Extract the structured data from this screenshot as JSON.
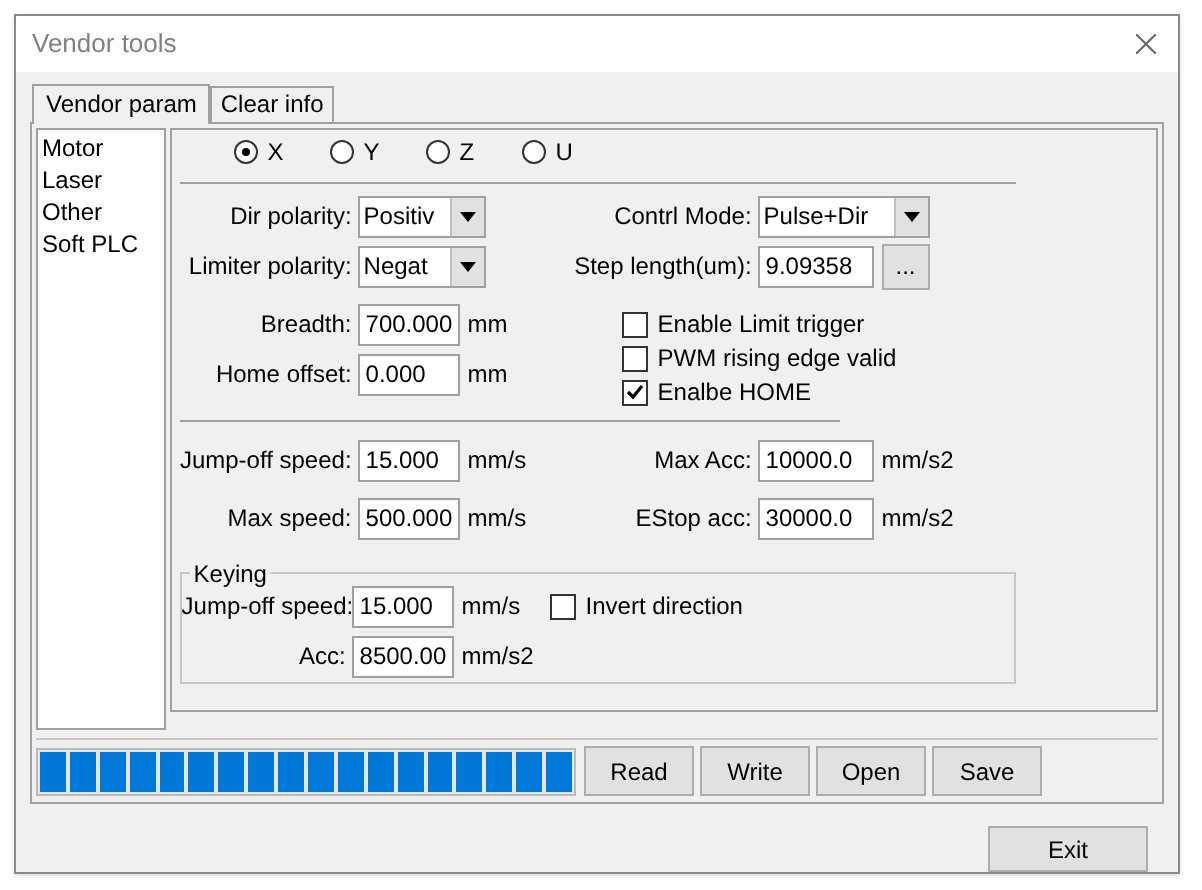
{
  "window": {
    "title": "Vendor tools"
  },
  "tabs": [
    {
      "label": "Vendor param",
      "selected": true
    },
    {
      "label": "Clear info",
      "selected": false
    }
  ],
  "sidebar": {
    "items": [
      "Motor",
      "Laser",
      "Other",
      "Soft PLC"
    ]
  },
  "axes": [
    {
      "label": "X",
      "selected": true
    },
    {
      "label": "Y",
      "selected": false
    },
    {
      "label": "Z",
      "selected": false
    },
    {
      "label": "U",
      "selected": false
    }
  ],
  "motor": {
    "dir_polarity": {
      "label": "Dir polarity:",
      "value": "Positiv"
    },
    "limiter_polarity": {
      "label": "Limiter polarity:",
      "value": "Negat"
    },
    "breadth": {
      "label": "Breadth:",
      "value": "700.000",
      "unit": "mm"
    },
    "home_offset": {
      "label": "Home offset:",
      "value": "0.000",
      "unit": "mm"
    },
    "control_mode": {
      "label": "Contrl Mode:",
      "value": "Pulse+Dir"
    },
    "step_length": {
      "label": "Step length(um):",
      "value": "9.09358",
      "button": "..."
    },
    "options": [
      {
        "label": "Enable Limit trigger",
        "checked": false
      },
      {
        "label": "PWM rising edge valid",
        "checked": false
      },
      {
        "label": "Enalbe HOME",
        "checked": true
      }
    ],
    "jump_off_speed": {
      "label": "Jump-off speed:",
      "value": "15.000",
      "unit": "mm/s"
    },
    "max_speed": {
      "label": "Max speed:",
      "value": "500.000",
      "unit": "mm/s"
    },
    "max_acc": {
      "label": "Max Acc:",
      "value": "10000.0",
      "unit": "mm/s2"
    },
    "estop_acc": {
      "label": "EStop acc:",
      "value": "30000.0",
      "unit": "mm/s2"
    },
    "keying": {
      "title": "Keying",
      "jump_off_speed": {
        "label": "Jump-off speed:",
        "value": "15.000",
        "unit": "mm/s"
      },
      "acc": {
        "label": "Acc:",
        "value": "8500.00",
        "unit": "mm/s2"
      },
      "invert": {
        "label": "Invert direction",
        "checked": false
      }
    }
  },
  "progress": {
    "level": 1
  },
  "actions": [
    "Read",
    "Write",
    "Open",
    "Save"
  ],
  "exit": "Exit"
}
